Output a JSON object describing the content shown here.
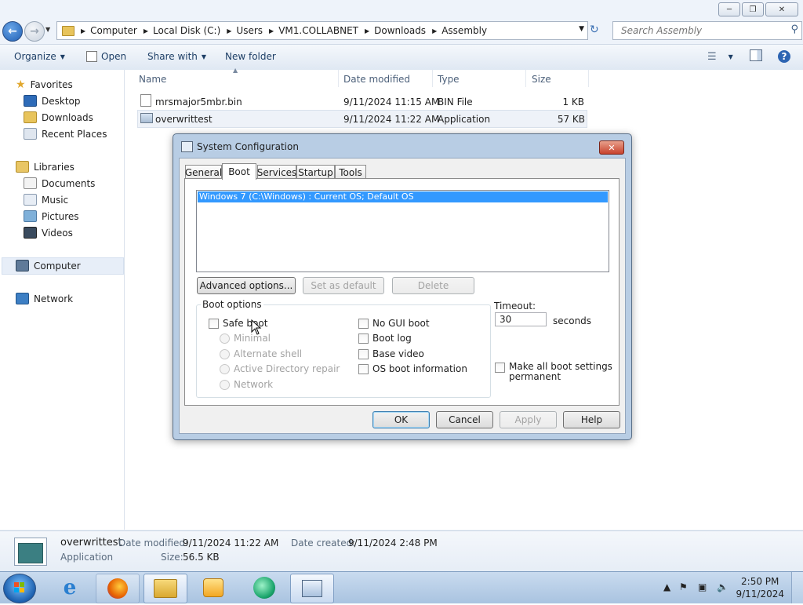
{
  "explorer": {
    "address": {
      "crumbs": [
        "Computer",
        "Local Disk (C:)",
        "Users",
        "VM1.COLLABNET",
        "Downloads",
        "Assembly"
      ]
    },
    "search": {
      "placeholder": "Search Assembly"
    },
    "commandbar": {
      "organize": "Organize",
      "open": "Open",
      "share_with": "Share with",
      "new_folder": "New folder"
    },
    "nav": {
      "favorites": "Favorites",
      "desktop": "Desktop",
      "downloads": "Downloads",
      "recent_places": "Recent Places",
      "libraries": "Libraries",
      "documents": "Documents",
      "music": "Music",
      "pictures": "Pictures",
      "videos": "Videos",
      "computer": "Computer",
      "network": "Network"
    },
    "columns": {
      "name": "Name",
      "date_modified": "Date modified",
      "type": "Type",
      "size": "Size"
    },
    "files": [
      {
        "name": "mrsmajor5mbr.bin",
        "date": "9/11/2024 11:15 AM",
        "type": "BIN File",
        "size": "1 KB"
      },
      {
        "name": "overwrittest",
        "date": "9/11/2024 11:22 AM",
        "type": "Application",
        "size": "57 KB"
      }
    ],
    "details": {
      "name": "overwrittest",
      "type": "Application",
      "date_modified_label": "Date modified:",
      "date_modified": "9/11/2024 11:22 AM",
      "date_created_label": "Date created:",
      "date_created": "9/11/2024 2:48 PM",
      "size_label": "Size:",
      "size": "56.5 KB"
    }
  },
  "dialog": {
    "title": "System Configuration",
    "tabs": [
      "General",
      "Boot",
      "Services",
      "Startup",
      "Tools"
    ],
    "active_tab": "Boot",
    "os_entry": "Windows 7 (C:\\Windows) : Current OS; Default OS",
    "buttons": {
      "advanced": "Advanced options...",
      "set_default": "Set as default",
      "delete": "Delete",
      "ok": "OK",
      "cancel": "Cancel",
      "apply": "Apply",
      "help": "Help"
    },
    "boot_options": {
      "label": "Boot options",
      "safe_boot": "Safe boot",
      "minimal": "Minimal",
      "alternate_shell": "Alternate shell",
      "ad_repair": "Active Directory repair",
      "network": "Network",
      "no_gui_boot": "No GUI boot",
      "boot_log": "Boot log",
      "base_video": "Base video",
      "os_boot_info": "OS boot information"
    },
    "timeout": {
      "label": "Timeout:",
      "value": "30",
      "unit": "seconds"
    },
    "make_permanent_line1": "Make all boot settings",
    "make_permanent_line2": "permanent"
  },
  "taskbar": {
    "time": "2:50 PM",
    "date": "9/11/2024"
  },
  "colors": {
    "selection": "#3399ff",
    "dialog_frame": "#b8cde4",
    "taskbar": "#b6cde6"
  }
}
